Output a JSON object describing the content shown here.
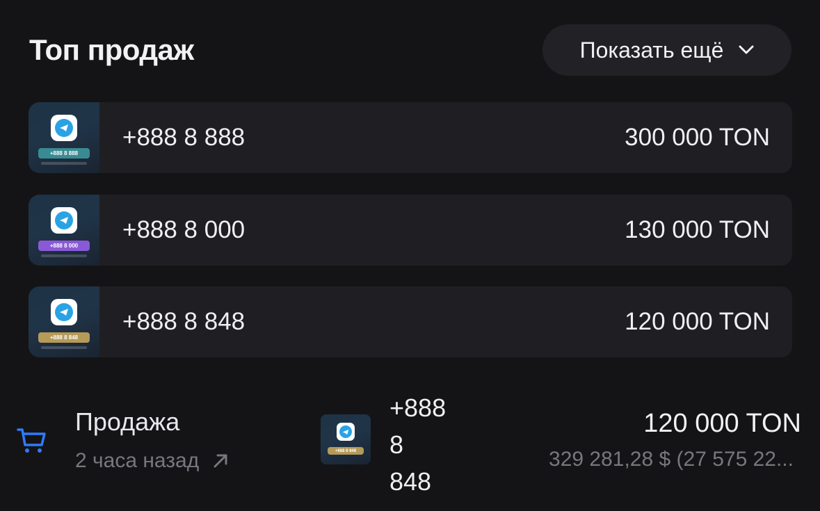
{
  "header": {
    "title": "Топ продаж",
    "show_more_label": "Показать ещё"
  },
  "top_sales": [
    {
      "number": "+888 8 888",
      "price": "300 000 TON",
      "badge_text": "+888 8 888",
      "badge_color": "#3a8a93"
    },
    {
      "number": "+888 8 000",
      "price": "130 000 TON",
      "badge_text": "+888 8 000",
      "badge_color": "#8a5ad6"
    },
    {
      "number": "+888 8 848",
      "price": "120 000 TON",
      "badge_text": "+888 8 848",
      "badge_color": "#b59a58"
    }
  ],
  "recent_sale": {
    "type_label": "Продажа",
    "time": "2 часа назад",
    "number_lines": [
      "+888",
      "8",
      "848"
    ],
    "badge_text": "+888 8 848",
    "badge_color": "#b59a58",
    "price": "120 000 TON",
    "usd_value": "329 281,28 $ (27 575 22..."
  },
  "colors": {
    "background": "#141416",
    "card": "#1f1f23",
    "button": "#222226",
    "accent_blue": "#2f7bff",
    "muted_text": "#77777e"
  },
  "icons": {
    "chevron": "chevron-down-icon",
    "cart": "cart-icon",
    "external": "arrow-up-right-icon",
    "telegram": "telegram-icon"
  }
}
